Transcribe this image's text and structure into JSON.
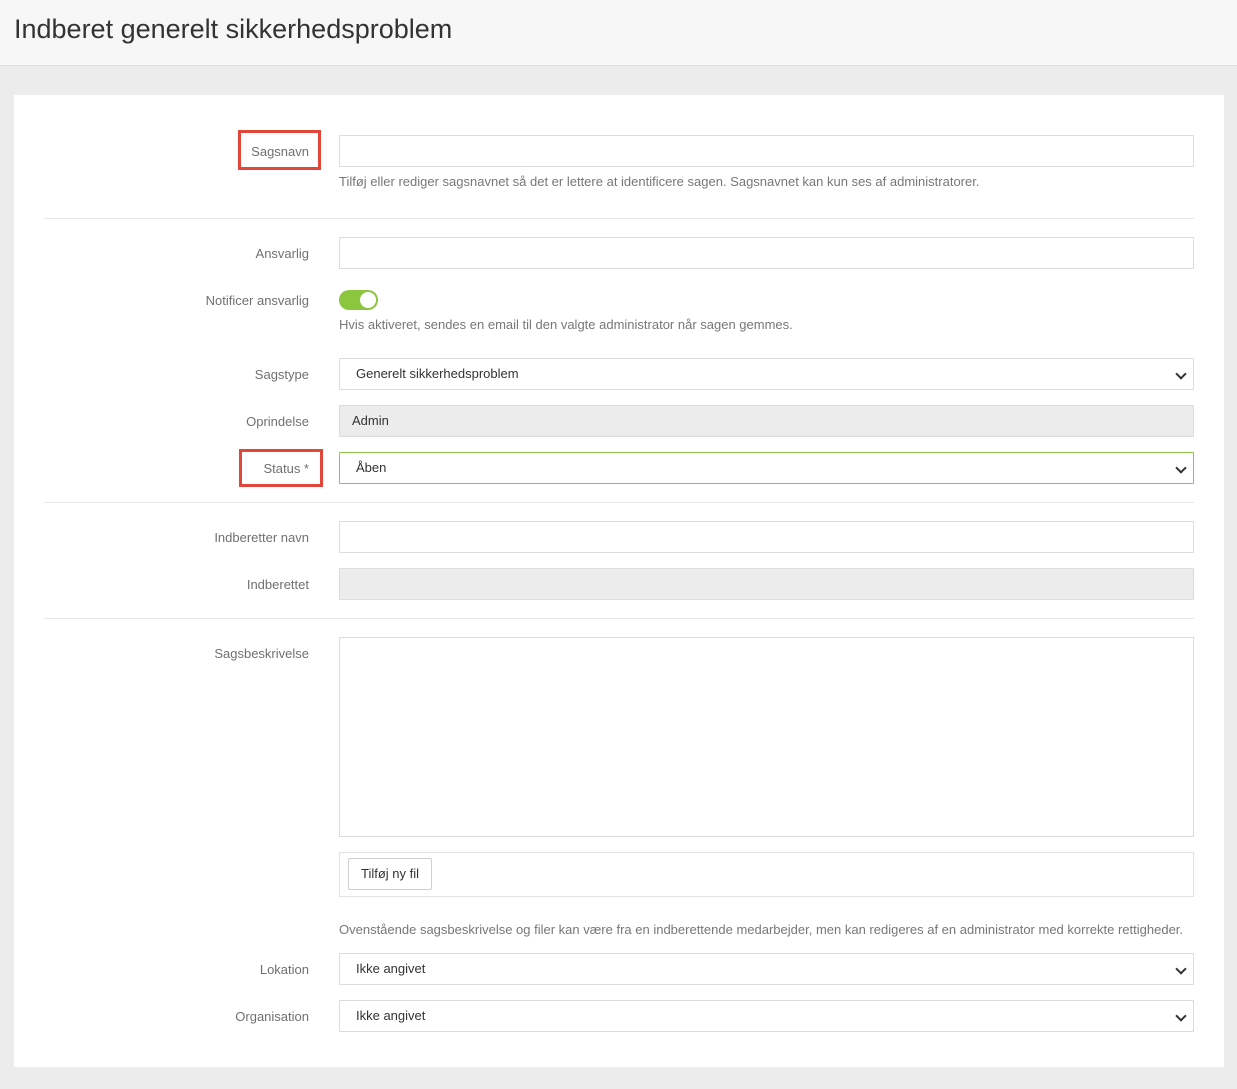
{
  "page": {
    "title": "Indberet generelt sikkerhedsproblem"
  },
  "form": {
    "case_name": {
      "label": "Sagsnavn",
      "value": "",
      "help": "Tilføj eller rediger sagsnavnet så det er lettere at identificere sagen. Sagsnavnet kan kun ses af administratorer."
    },
    "responsible": {
      "label": "Ansvarlig",
      "value": ""
    },
    "notify": {
      "label": "Notificer ansvarlig",
      "enabled": true,
      "help": "Hvis aktiveret, sendes en email til den valgte administrator når sagen gemmes."
    },
    "case_type": {
      "label": "Sagstype",
      "selected": "Generelt sikkerhedsproblem"
    },
    "origin": {
      "label": "Oprindelse",
      "value": "Admin"
    },
    "status": {
      "label": "Status *",
      "selected": "Åben"
    },
    "reporter_name": {
      "label": "Indberetter navn",
      "value": ""
    },
    "reported": {
      "label": "Indberettet",
      "value": ""
    },
    "description": {
      "label": "Sagsbeskrivelse",
      "value": "",
      "add_file_label": "Tilføj ny fil",
      "help": "Ovenstående sagsbeskrivelse og filer kan være fra en indberettende medarbejder, men kan redigeres af en administrator med korrekte rettigheder."
    },
    "location": {
      "label": "Lokation",
      "selected": "Ikke angivet"
    },
    "organisation": {
      "label": "Organisation",
      "selected": "Ikke angivet"
    }
  },
  "colors": {
    "accent_green": "#8cc63f",
    "highlight_red": "#e0463a",
    "valid_border": "#8fc54a"
  }
}
